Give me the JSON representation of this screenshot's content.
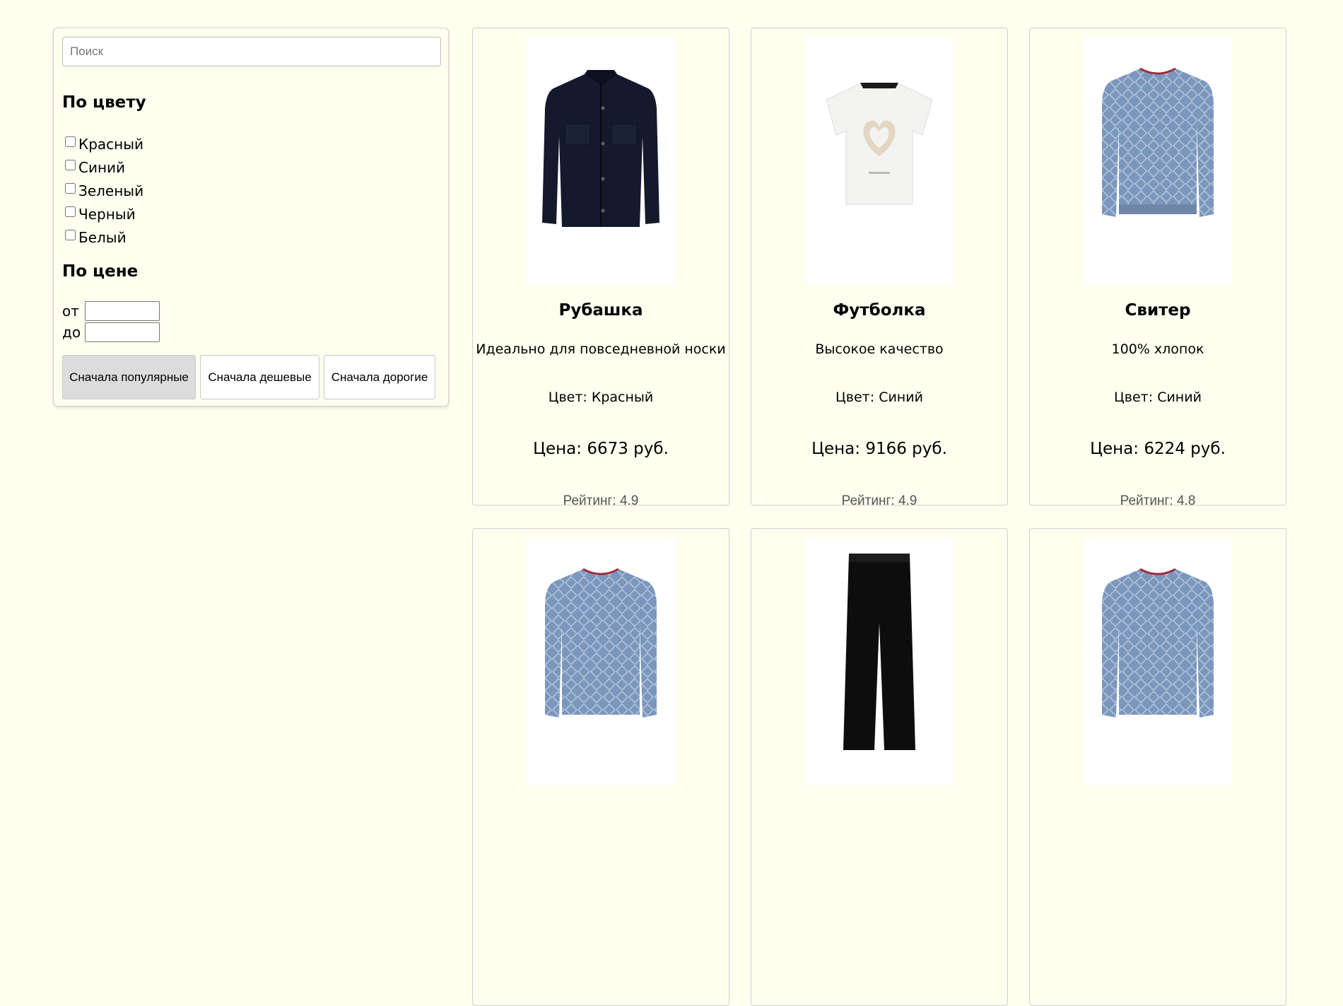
{
  "search": {
    "placeholder": "Поиск"
  },
  "filters": {
    "color_title": "По цвету",
    "colors": [
      "Красный",
      "Синий",
      "Зеленый",
      "Черный",
      "Белый"
    ],
    "price_title": "По цене",
    "from_label": "от",
    "to_label": "до"
  },
  "sort": {
    "popular": "Сначала популярные",
    "cheap": "Сначала дешевые",
    "expensive": "Сначала дорогие"
  },
  "products": [
    {
      "name": "Рубашка",
      "description": "Идеально для повседневной носки",
      "color": "Цвет: Красный",
      "price": "Цена: 6673 руб.",
      "rating": "Рейтинг: 4.9",
      "image": "shirt-dark-navy"
    },
    {
      "name": "Футболка",
      "description": "Высокое качество",
      "color": "Цвет: Синий",
      "price": "Цена: 9166 руб.",
      "rating": "Рейтинг: 4.9",
      "image": "tshirt-white-heart"
    },
    {
      "name": "Свитер",
      "description": "100% хлопок",
      "color": "Цвет: Синий",
      "price": "Цена: 6224 руб.",
      "rating": "Рейтинг: 4.8",
      "image": "sweater-blue-pattern"
    },
    {
      "image": "sweater-blue-pattern"
    },
    {
      "image": "trousers-black"
    },
    {
      "image": "sweater-blue-pattern"
    }
  ]
}
